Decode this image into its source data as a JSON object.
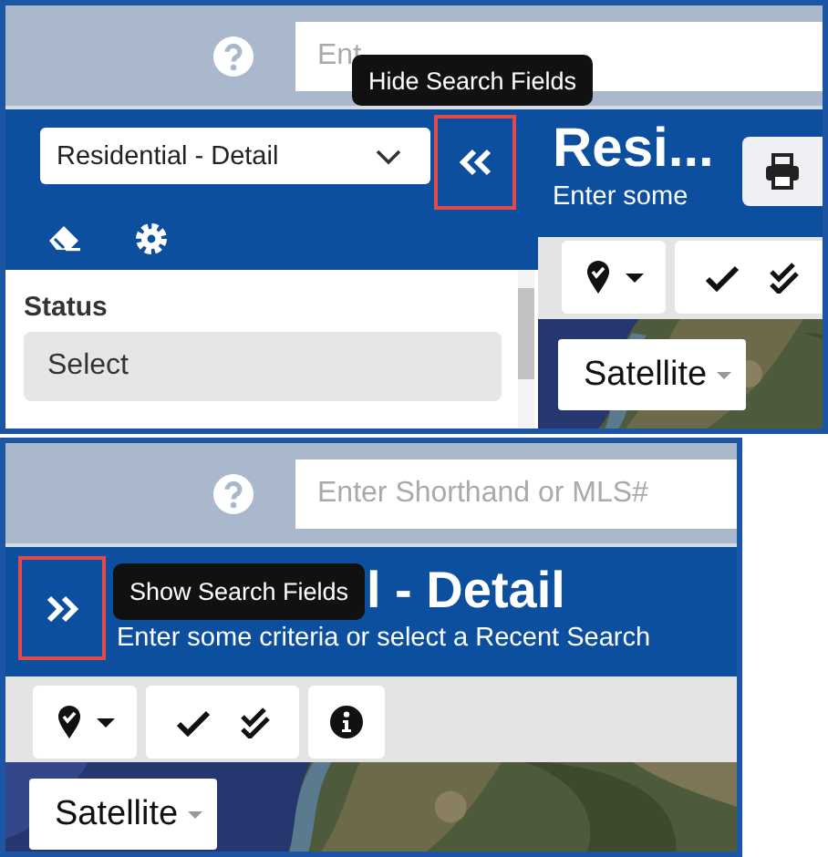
{
  "expanded_view": {
    "header": {
      "search": {
        "placeholder": "Ent"
      }
    },
    "sidebar": {
      "search_type": "Residential - Detail",
      "toggle": {
        "highlighted": true,
        "tooltip": "Hide Search Fields"
      },
      "fields": [
        {
          "label": "Status",
          "value": "Select"
        }
      ]
    },
    "content": {
      "title": "Resi...",
      "subtitle": "Enter some"
    },
    "toolbar": [
      {
        "kind": "pin-menu"
      },
      {
        "kind": "checks"
      }
    ],
    "map": {
      "layer": "Satellite"
    }
  },
  "collapsed_view": {
    "header": {
      "search": {
        "placeholder": "Enter Shorthand or MLS#"
      }
    },
    "toggle": {
      "highlighted": true,
      "tooltip": "Show Search Fields"
    },
    "content": {
      "title": "l - Detail",
      "subtitle": "Enter some criteria or select a Recent Search"
    },
    "toolbar": [
      {
        "kind": "pin-menu"
      },
      {
        "kind": "checks"
      },
      {
        "kind": "info"
      }
    ],
    "map": {
      "layer": "Satellite"
    }
  }
}
